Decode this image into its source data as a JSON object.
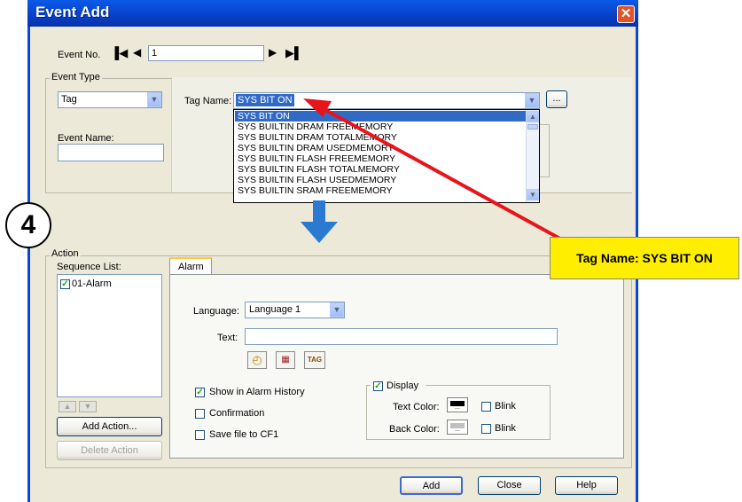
{
  "window": {
    "title": "Event Add",
    "close_glyph": "✕"
  },
  "event_no": {
    "label": "Event No.",
    "value": "1"
  },
  "event_type": {
    "group_label": "Event Type",
    "type_value": "Tag",
    "event_name_label": "Event Name:",
    "event_name_value": "",
    "tag_name_label": "Tag Name:",
    "tag_name_value": "SYS BIT ON",
    "browse_label": "...",
    "options": [
      "SYS BIT ON",
      "SYS BUILTIN DRAM FREEMEMORY",
      "SYS BUILTIN DRAM TOTALMEMORY",
      "SYS BUILTIN DRAM USEDMEMORY",
      "SYS BUILTIN FLASH FREEMEMORY",
      "SYS BUILTIN FLASH TOTALMEMORY",
      "SYS BUILTIN FLASH USEDMEMORY",
      "SYS BUILTIN SRAM FREEMEMORY"
    ]
  },
  "step_badge": "4",
  "callout": {
    "text": "Tag Name: SYS BIT ON",
    "color": "#ffee00",
    "arrow_color": "#e8141b"
  },
  "action": {
    "group_label": "Action",
    "sequence_label": "Sequence List:",
    "sequence_items": [
      "01-Alarm"
    ],
    "up_glyph": "▲",
    "down_glyph": "▼",
    "add_action_label": "Add Action...",
    "delete_action_label": "Delete Action"
  },
  "alarm_tab": {
    "tab_label": "Alarm",
    "language_label": "Language:",
    "language_value": "Language 1",
    "text_label": "Text:",
    "text_value": "",
    "tool_icons": [
      "clock-icon",
      "calendar-icon",
      "tag-icon"
    ],
    "tag_icon_text": "TAG",
    "show_history_label": "Show in Alarm History",
    "show_history_checked": true,
    "confirmation_label": "Confirmation",
    "confirmation_checked": false,
    "save_file_label": "Save file to CF1",
    "save_file_checked": false,
    "display_group_label": "Display",
    "display_checked": true,
    "text_color_label": "Text Color:",
    "text_color": "#000000",
    "back_color_label": "Back Color:",
    "back_color": "#c0c0c0",
    "blink_label": "Blink",
    "swatch_glyph": "..."
  },
  "footer": {
    "add_label": "Add",
    "close_label": "Close",
    "help_label": "Help"
  },
  "nav_glyphs": {
    "first": "⏮",
    "prev": "◀",
    "next": "▶",
    "last": "⏭"
  },
  "check_glyph": "✓",
  "dropdown_glyph": "⌄"
}
